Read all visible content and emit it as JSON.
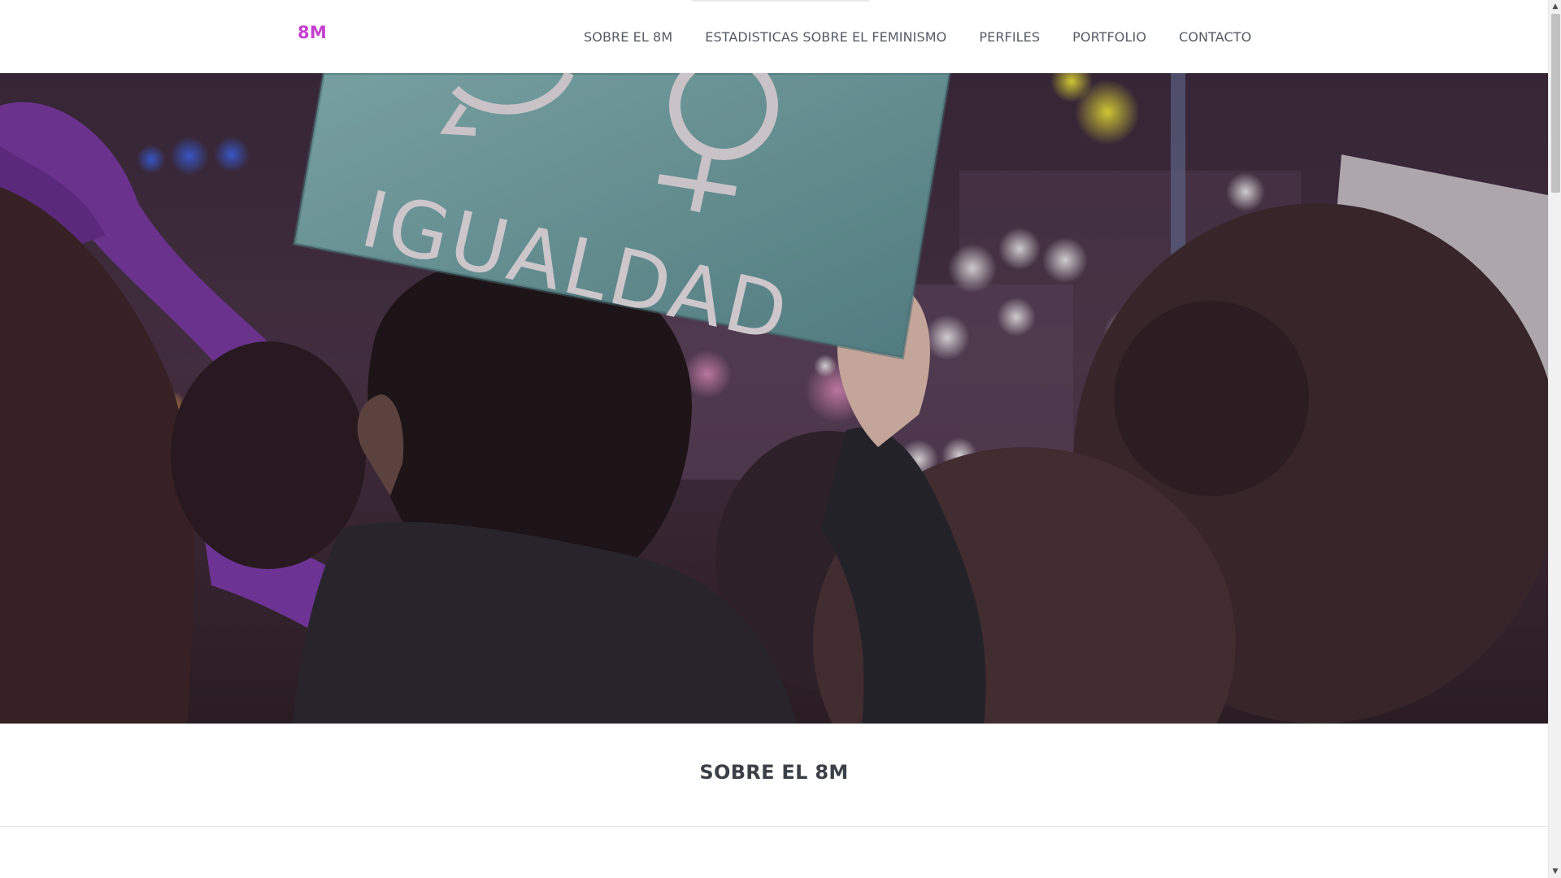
{
  "navbar": {
    "brand": "8M",
    "links": [
      {
        "label": "SOBRE EL 8M"
      },
      {
        "label": "ESTADISTICAS SOBRE EL FEMINISMO"
      },
      {
        "label": "PERFILES"
      },
      {
        "label": "PORTFOLIO"
      },
      {
        "label": "CONTACTO"
      }
    ]
  },
  "hero": {
    "sign_text": "IGUALDAD"
  },
  "section": {
    "title": "SOBRE EL 8M"
  },
  "colors": {
    "brand": "#c53fd0",
    "nav_text": "#555a64",
    "title_text": "#3b4048",
    "sign": "#6aa3a6",
    "ribbon": "#8b3fb4"
  },
  "scrollbar": {
    "up_icon": "triangle-up-icon",
    "down_icon": "triangle-down-icon"
  }
}
